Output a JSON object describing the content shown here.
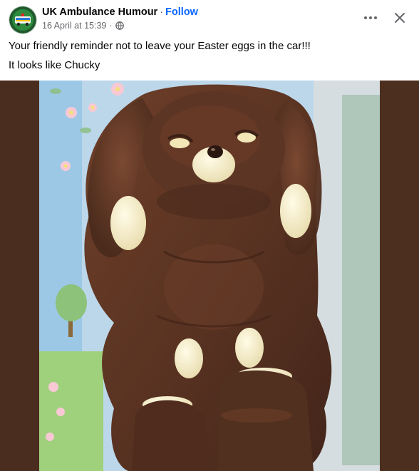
{
  "post": {
    "author": "UK Ambulance Humour",
    "separator": "·",
    "follow_label": "Follow",
    "timestamp": "16 April at 15:39",
    "timestamp_dot": "·",
    "caption_line1": "Your friendly reminder not to leave your Easter eggs in the car!!!",
    "caption_line2": "It looks like Chucky"
  },
  "icons": {
    "audience": "globe-icon",
    "more": "more-dots-icon",
    "close": "close-icon"
  },
  "colors": {
    "link": "#0866ff",
    "secondary_text": "#65676b",
    "chocolate": "#5a3322",
    "background_dark": "#4e2f1e"
  }
}
